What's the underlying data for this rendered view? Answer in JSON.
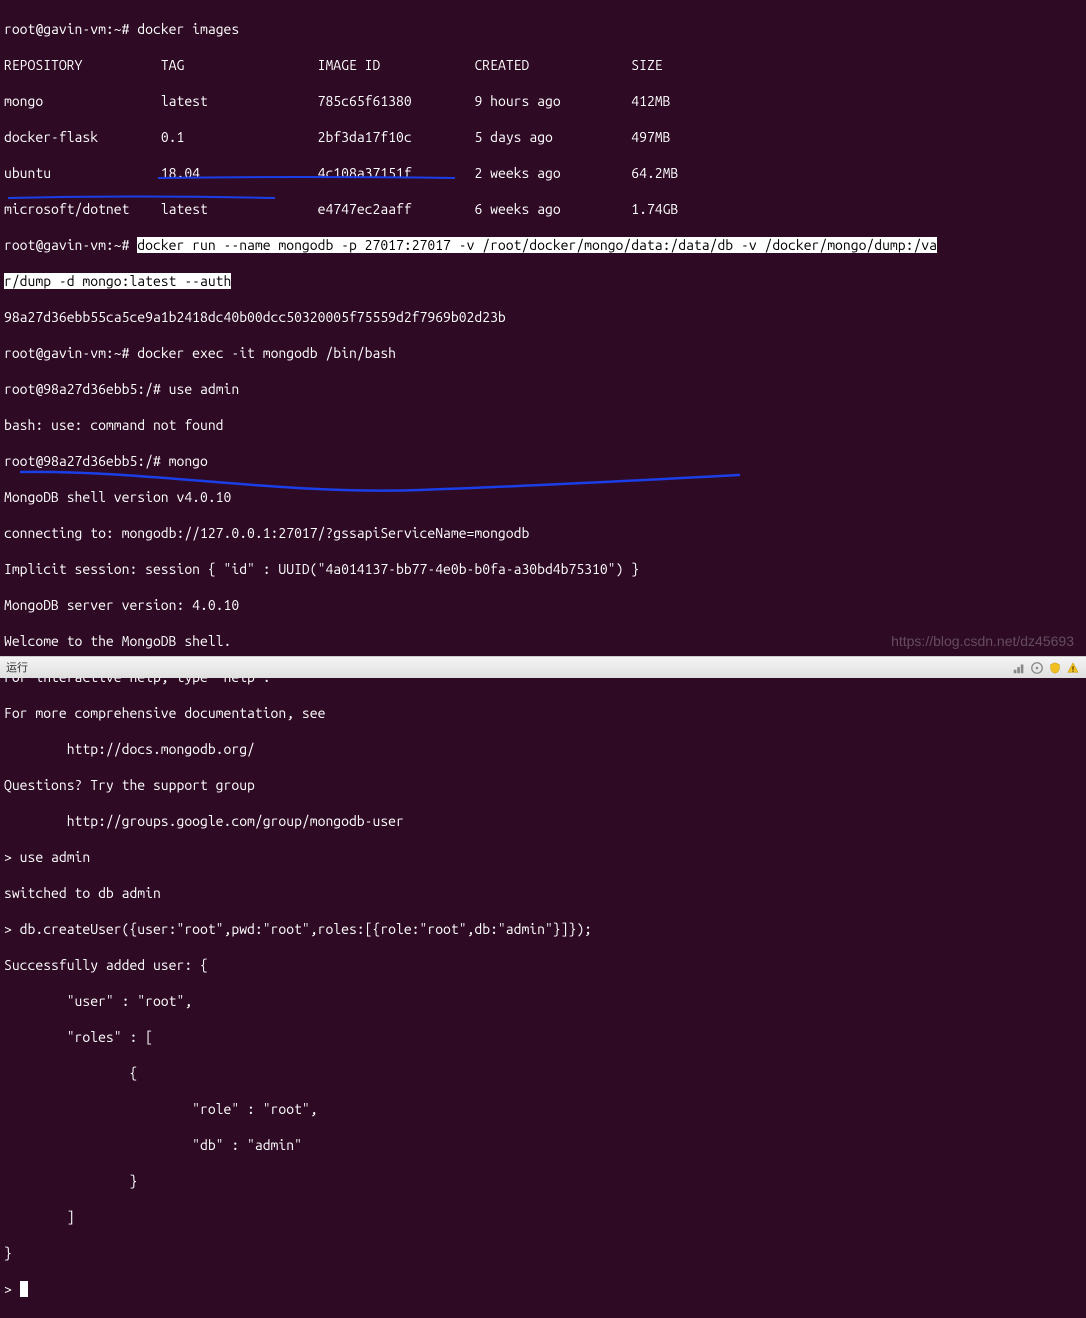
{
  "prompts": {
    "p1": "root@gavin-vm:~#",
    "p2": "root@gavin-vm:~#",
    "p3": "root@gavin-vm:~#",
    "p4": "root@98a27d36ebb5:/#",
    "p5": "root@98a27d36ebb5:/#"
  },
  "commands": {
    "docker_images": "docker images",
    "docker_run_hl1": "docker run --name mongodb -p 27017:27017 -v /root/docker/mongo/data:/data/db -v /docker/mongo/dump:/va",
    "docker_run_hl2": "r/dump -d mongo:latest --auth",
    "docker_exec": "docker exec -it mongodb /bin/bash",
    "use_admin": "use admin",
    "mongo": "mongo"
  },
  "docker_header": {
    "c1": "REPOSITORY",
    "c2": "TAG",
    "c3": "IMAGE ID",
    "c4": "CREATED",
    "c5": "SIZE"
  },
  "docker_rows": [
    {
      "c1": "mongo",
      "c2": "latest",
      "c3": "785c65f61380",
      "c4": "9 hours ago",
      "c5": "412MB"
    },
    {
      "c1": "docker-flask",
      "c2": "0.1",
      "c3": "2bf3da17f10c",
      "c4": "5 days ago",
      "c5": "497MB"
    },
    {
      "c1": "ubuntu",
      "c2": "18.04",
      "c3": "4c108a37151f",
      "c4": "2 weeks ago",
      "c5": "64.2MB"
    },
    {
      "c1": "microsoft/dotnet",
      "c2": "latest",
      "c3": "e4747ec2aaff",
      "c4": "6 weeks ago",
      "c5": "1.74GB"
    }
  ],
  "container_id": "98a27d36ebb55ca5ce9a1b2418dc40b00dcc50320005f75559d2f7969b02d23b",
  "bash_error": "bash: use: command not found",
  "mongo_lines": {
    "l1": "MongoDB shell version v4.0.10",
    "l2": "connecting to: mongodb://127.0.0.1:27017/?gssapiServiceName=mongodb",
    "l3": "Implicit session: session { \"id\" : UUID(\"4a014137-bb77-4e0b-b0fa-a30bd4b75310\") }",
    "l4": "MongoDB server version: 4.0.10",
    "l5": "Welcome to the MongoDB shell.",
    "l6": "For interactive help, type \"help\".",
    "l7": "For more comprehensive documentation, see",
    "l8": "        http://docs.mongodb.org/",
    "l9": "Questions? Try the support group",
    "l10": "        http://groups.google.com/group/mongodb-user"
  },
  "mongo_session": {
    "use_cmd": "> use admin",
    "switched": "switched to db admin",
    "create_user": "> db.createUser({user:\"root\",pwd:\"root\",roles:[{role:\"root\",db:\"admin\"}]});",
    "r1": "Successfully added user: {",
    "r2": "        \"user\" : \"root\",",
    "r3": "        \"roles\" : [",
    "r4": "                {",
    "r5": "                        \"role\" : \"root\",",
    "r6": "                        \"db\" : \"admin\"",
    "r7": "                }",
    "r8": "        ]",
    "r9": "}",
    "prompt": "> "
  },
  "watermark": "https://blog.csdn.net/dz45693",
  "statusbar": {
    "text": "运行"
  }
}
